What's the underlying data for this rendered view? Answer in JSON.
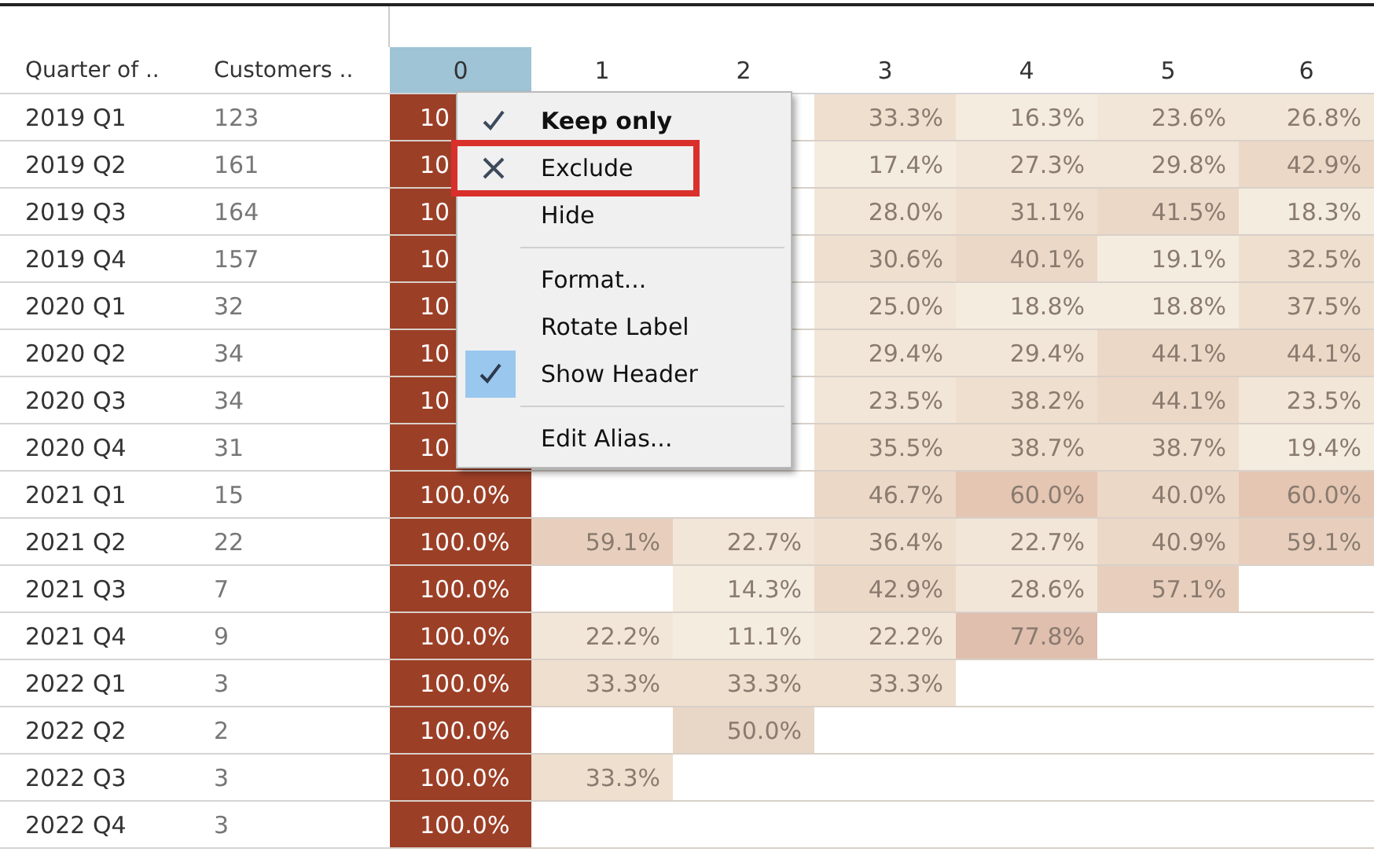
{
  "row_headers": [
    {
      "label": "Quarter of .."
    },
    {
      "label": "Customers .."
    }
  ],
  "columns": [
    {
      "label": "0",
      "selected": true
    },
    {
      "label": "1",
      "selected": false
    },
    {
      "label": "2",
      "selected": false
    },
    {
      "label": "3",
      "selected": false
    },
    {
      "label": "4",
      "selected": false
    },
    {
      "label": "5",
      "selected": false
    },
    {
      "label": "6",
      "selected": false
    }
  ],
  "rows": [
    {
      "quarter": "2019 Q1",
      "customers": "123",
      "cells": [
        {
          "text": "10",
          "color": "#9c3f27"
        },
        null,
        null,
        {
          "text": "33.3%",
          "color": "#efdfcf"
        },
        {
          "text": "16.3%",
          "color": "#f5ece0"
        },
        {
          "text": "23.6%",
          "color": "#f2e6d8"
        },
        {
          "text": "26.8%",
          "color": "#f2e6d8"
        }
      ]
    },
    {
      "quarter": "2019 Q2",
      "customers": "161",
      "cells": [
        {
          "text": "10",
          "color": "#9c3f27"
        },
        null,
        null,
        {
          "text": "17.4%",
          "color": "#f5ece0"
        },
        {
          "text": "27.3%",
          "color": "#f2e6d8"
        },
        {
          "text": "29.8%",
          "color": "#f2e6d8"
        },
        {
          "text": "42.9%",
          "color": "#ecd8c7"
        }
      ]
    },
    {
      "quarter": "2019 Q3",
      "customers": "164",
      "cells": [
        {
          "text": "10",
          "color": "#9c3f27"
        },
        null,
        null,
        {
          "text": "28.0%",
          "color": "#f2e6d8"
        },
        {
          "text": "31.1%",
          "color": "#efdfcf"
        },
        {
          "text": "41.5%",
          "color": "#ecd8c7"
        },
        {
          "text": "18.3%",
          "color": "#f5ece0"
        }
      ]
    },
    {
      "quarter": "2019 Q4",
      "customers": "157",
      "cells": [
        {
          "text": "10",
          "color": "#9c3f27"
        },
        null,
        null,
        {
          "text": "30.6%",
          "color": "#efdfcf"
        },
        {
          "text": "40.1%",
          "color": "#ecd8c7"
        },
        {
          "text": "19.1%",
          "color": "#f5ece0"
        },
        {
          "text": "32.5%",
          "color": "#efdfcf"
        }
      ]
    },
    {
      "quarter": "2020 Q1",
      "customers": "32",
      "cells": [
        {
          "text": "10",
          "color": "#9c3f27"
        },
        null,
        null,
        {
          "text": "25.0%",
          "color": "#f2e6d8"
        },
        {
          "text": "18.8%",
          "color": "#f5ece0"
        },
        {
          "text": "18.8%",
          "color": "#f5ece0"
        },
        {
          "text": "37.5%",
          "color": "#efdfcf"
        }
      ]
    },
    {
      "quarter": "2020 Q2",
      "customers": "34",
      "cells": [
        {
          "text": "10",
          "color": "#9c3f27"
        },
        null,
        null,
        {
          "text": "29.4%",
          "color": "#f2e6d8"
        },
        {
          "text": "29.4%",
          "color": "#f2e6d8"
        },
        {
          "text": "44.1%",
          "color": "#ecd8c7"
        },
        {
          "text": "44.1%",
          "color": "#ecd8c7"
        }
      ]
    },
    {
      "quarter": "2020 Q3",
      "customers": "34",
      "cells": [
        {
          "text": "10",
          "color": "#9c3f27"
        },
        null,
        null,
        {
          "text": "23.5%",
          "color": "#f2e6d8"
        },
        {
          "text": "38.2%",
          "color": "#efdfcf"
        },
        {
          "text": "44.1%",
          "color": "#ecd8c7"
        },
        {
          "text": "23.5%",
          "color": "#f2e6d8"
        }
      ]
    },
    {
      "quarter": "2020 Q4",
      "customers": "31",
      "cells": [
        {
          "text": "10",
          "color": "#9c3f27"
        },
        null,
        null,
        {
          "text": "35.5%",
          "color": "#efdfcf"
        },
        {
          "text": "38.7%",
          "color": "#efdfcf"
        },
        {
          "text": "38.7%",
          "color": "#efdfcf"
        },
        {
          "text": "19.4%",
          "color": "#f5ece0"
        }
      ]
    },
    {
      "quarter": "2021 Q1",
      "customers": "15",
      "cells": [
        {
          "text": "100.0%",
          "color": "#9c3f27"
        },
        null,
        null,
        {
          "text": "46.7%",
          "color": "#ecd8c7"
        },
        {
          "text": "60.0%",
          "color": "#e4c6b3"
        },
        {
          "text": "40.0%",
          "color": "#ecd8c7"
        },
        {
          "text": "60.0%",
          "color": "#e4c6b3"
        }
      ]
    },
    {
      "quarter": "2021 Q2",
      "customers": "22",
      "cells": [
        {
          "text": "100.0%",
          "color": "#9c3f27"
        },
        {
          "text": "59.1%",
          "color": "#e8cfbd"
        },
        {
          "text": "22.7%",
          "color": "#f2e6d8"
        },
        {
          "text": "36.4%",
          "color": "#efdfcf"
        },
        {
          "text": "22.7%",
          "color": "#f2e6d8"
        },
        {
          "text": "40.9%",
          "color": "#ecd8c7"
        },
        {
          "text": "59.1%",
          "color": "#e8cfbd"
        }
      ]
    },
    {
      "quarter": "2021 Q3",
      "customers": "7",
      "cells": [
        {
          "text": "100.0%",
          "color": "#9c3f27"
        },
        null,
        {
          "text": "14.3%",
          "color": "#f5ece0"
        },
        {
          "text": "42.9%",
          "color": "#ecd8c7"
        },
        {
          "text": "28.6%",
          "color": "#f2e6d8"
        },
        {
          "text": "57.1%",
          "color": "#e8cfbd"
        },
        null
      ]
    },
    {
      "quarter": "2021 Q4",
      "customers": "9",
      "cells": [
        {
          "text": "100.0%",
          "color": "#9c3f27"
        },
        {
          "text": "22.2%",
          "color": "#f2e6d8"
        },
        {
          "text": "11.1%",
          "color": "#f5ece0"
        },
        {
          "text": "22.2%",
          "color": "#f2e6d8"
        },
        {
          "text": "77.8%",
          "color": "#e0bfae"
        },
        null,
        null
      ]
    },
    {
      "quarter": "2022 Q1",
      "customers": "3",
      "cells": [
        {
          "text": "100.0%",
          "color": "#9c3f27"
        },
        {
          "text": "33.3%",
          "color": "#efdfcf"
        },
        {
          "text": "33.3%",
          "color": "#efdfcf"
        },
        {
          "text": "33.3%",
          "color": "#efdfcf"
        },
        null,
        null,
        null
      ]
    },
    {
      "quarter": "2022 Q2",
      "customers": "2",
      "cells": [
        {
          "text": "100.0%",
          "color": "#9c3f27"
        },
        null,
        {
          "text": "50.0%",
          "color": "#e8d6c6"
        },
        null,
        null,
        null,
        null
      ]
    },
    {
      "quarter": "2022 Q3",
      "customers": "3",
      "cells": [
        {
          "text": "100.0%",
          "color": "#9c3f27"
        },
        {
          "text": "33.3%",
          "color": "#efdfcf"
        },
        null,
        null,
        null,
        null,
        null
      ]
    },
    {
      "quarter": "2022 Q4",
      "customers": "3",
      "cells": [
        {
          "text": "100.0%",
          "color": "#9c3f27"
        },
        null,
        null,
        null,
        null,
        null,
        null
      ]
    }
  ],
  "context_menu": {
    "items": [
      {
        "kind": "check",
        "label": "Keep only",
        "default": true,
        "highlighted": false
      },
      {
        "kind": "cross",
        "label": "Exclude",
        "default": false,
        "highlighted": true
      },
      {
        "kind": "action",
        "label": "Hide",
        "default": false,
        "highlighted": false
      },
      {
        "kind": "separator"
      },
      {
        "kind": "action",
        "label": "Format...",
        "default": false,
        "highlighted": false
      },
      {
        "kind": "action",
        "label": "Rotate Label",
        "default": false,
        "highlighted": false
      },
      {
        "kind": "toggle",
        "label": "Show Header",
        "checked": true
      },
      {
        "kind": "separator"
      },
      {
        "kind": "action",
        "label": "Edit Alias...",
        "default": false,
        "highlighted": false
      }
    ]
  }
}
